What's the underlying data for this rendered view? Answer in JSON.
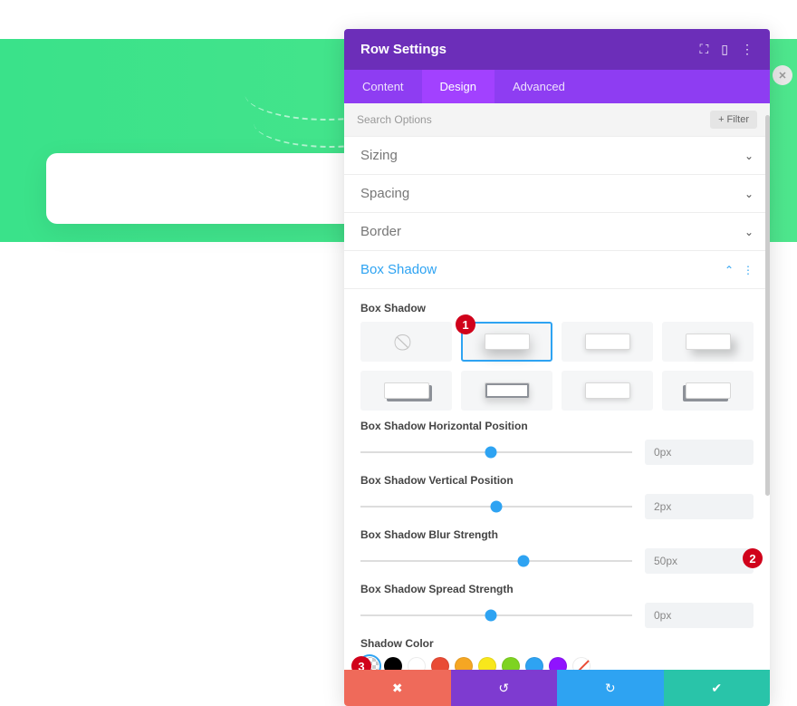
{
  "header": {
    "title": "Row Settings"
  },
  "tabs": {
    "content": "Content",
    "design": "Design",
    "advanced": "Advanced",
    "active": "design"
  },
  "search": {
    "placeholder": "Search Options",
    "filter": "Filter"
  },
  "sections": {
    "sizing": "Sizing",
    "spacing": "Spacing",
    "border": "Border",
    "box_shadow": "Box Shadow"
  },
  "box_shadow": {
    "label": "Box Shadow",
    "horiz": {
      "label": "Box Shadow Horizontal Position",
      "value": "0px",
      "pct": 48
    },
    "vert": {
      "label": "Box Shadow Vertical Position",
      "value": "2px",
      "pct": 50
    },
    "blur": {
      "label": "Box Shadow Blur Strength",
      "value": "50px",
      "pct": 60
    },
    "spread": {
      "label": "Box Shadow Spread Strength",
      "value": "0px",
      "pct": 48
    },
    "color_label": "Shadow Color"
  },
  "colors": {
    "transparent": "transparent",
    "black": "#000000",
    "white": "#ffffff",
    "red": "#e94b35",
    "orange": "#f5a623",
    "yellow": "#f8e71c",
    "green": "#7ed321",
    "blue": "#2ea3f2",
    "purple": "#9013fe"
  },
  "badges": {
    "b1": "1",
    "b2": "2",
    "b3": "3"
  },
  "footer_icons": {
    "cancel": "✖",
    "undo": "↺",
    "redo": "↻",
    "save": "✔"
  }
}
